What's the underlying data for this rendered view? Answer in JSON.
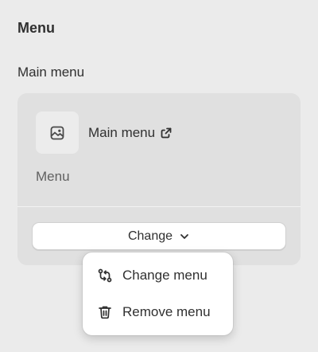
{
  "section": {
    "title": "Menu"
  },
  "field": {
    "label": "Main menu"
  },
  "card": {
    "thumb_icon": "image-icon",
    "menu_name": "Main menu",
    "external_link_icon": "external-link-icon",
    "menu_type": "Menu",
    "change_button": {
      "label": "Change",
      "icon": "chevron-down-icon"
    }
  },
  "popover": {
    "items": [
      {
        "label": "Change menu",
        "icon": "swap-icon"
      },
      {
        "label": "Remove menu",
        "icon": "trash-icon"
      }
    ]
  }
}
